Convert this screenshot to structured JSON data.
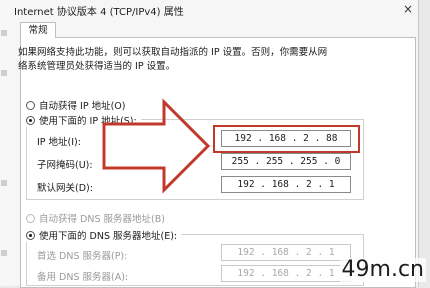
{
  "window": {
    "title": "Internet 协议版本 4 (TCP/IPv4) 属性",
    "close_glyph": "×"
  },
  "tabs": [
    {
      "label": "常规"
    }
  ],
  "description": [
    "如果网络支持此功能，则可以获取自动指派的 IP 设置。否则，你需要从网",
    "络系统管理员处获得适当的 IP 设置。"
  ],
  "ip_section": {
    "auto_option": "自动获得 IP 地址(O)",
    "manual_option": "使用下面的 IP 地址(S):",
    "fields": [
      {
        "label": "IP 地址(I):",
        "value": "192 . 168 . 2 . 88"
      },
      {
        "label": "子网掩码(U):",
        "value": "255 . 255 . 255 . 0"
      },
      {
        "label": "默认网关(D):",
        "value": "192 . 168 . 2 . 1"
      }
    ]
  },
  "dns_section": {
    "auto_option": "自动获得 DNS 服务器地址(B)",
    "manual_option": "使用下面的 DNS 服务器地址(E):",
    "fields": [
      {
        "label": "首选 DNS 服务器(P):",
        "value": "192 . 168 . 2 . 1"
      },
      {
        "label": "备用 DNS 服务器(A):",
        "value": "192 . 168 . 2 . 1"
      }
    ]
  },
  "watermark": "49m.cn",
  "colors": {
    "highlight": "#c0392b",
    "panel": "#ffffff"
  }
}
